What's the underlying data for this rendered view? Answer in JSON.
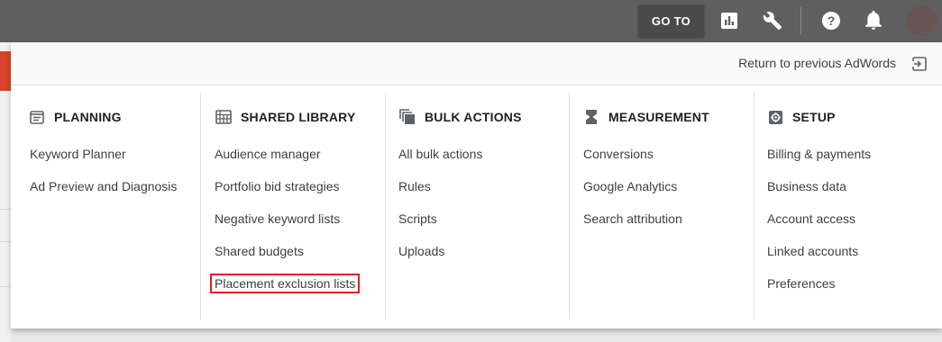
{
  "topbar": {
    "goto_label": "GO TO",
    "icons": [
      "reports-icon",
      "tools-icon",
      "help-icon",
      "notifications-icon"
    ]
  },
  "panel": {
    "return_label": "Return to previous AdWords",
    "columns": [
      {
        "heading": "PLANNING",
        "icon": "planning-icon",
        "items": [
          "Keyword Planner",
          "Ad Preview and Diagnosis"
        ]
      },
      {
        "heading": "SHARED LIBRARY",
        "icon": "shared-library-icon",
        "items": [
          "Audience manager",
          "Portfolio bid strategies",
          "Negative keyword lists",
          "Shared budgets",
          "Placement exclusion lists"
        ],
        "highlighted_item": "Placement exclusion lists"
      },
      {
        "heading": "BULK ACTIONS",
        "icon": "bulk-actions-icon",
        "items": [
          "All bulk actions",
          "Rules",
          "Scripts",
          "Uploads"
        ]
      },
      {
        "heading": "MEASUREMENT",
        "icon": "measurement-icon",
        "items": [
          "Conversions",
          "Google Analytics",
          "Search attribution"
        ]
      },
      {
        "heading": "SETUP",
        "icon": "setup-icon",
        "items": [
          "Billing & payments",
          "Business data",
          "Account access",
          "Linked accounts",
          "Preferences"
        ]
      }
    ]
  },
  "colors": {
    "topbar": "#5f5f5f",
    "goto_button": "#4a4a4a",
    "highlight_border": "#e02020",
    "side_accent": "#d8432c"
  }
}
